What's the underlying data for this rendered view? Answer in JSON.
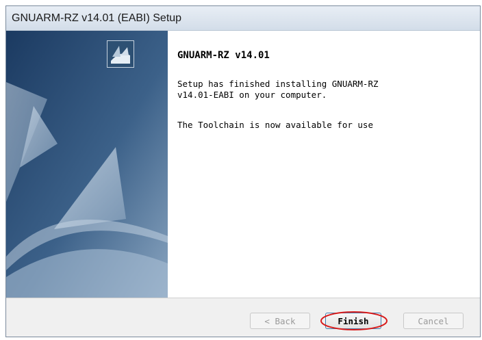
{
  "window": {
    "title": "GNUARM-RZ v14.01 (EABI) Setup"
  },
  "content": {
    "heading": "GNUARM-RZ v14.01",
    "message": "Setup has finished installing GNUARM-RZ\nv14.01-EABI on your computer.",
    "message2": "The Toolchain is now available for use"
  },
  "buttons": {
    "back": "< Back",
    "finish": "Finish",
    "cancel": "Cancel"
  },
  "colors": {
    "banner_dark": "#1d3f66",
    "banner_mid": "#6f8fae",
    "highlight": "#d81b1b"
  },
  "icons": {
    "setup": "setup-logo-icon"
  }
}
